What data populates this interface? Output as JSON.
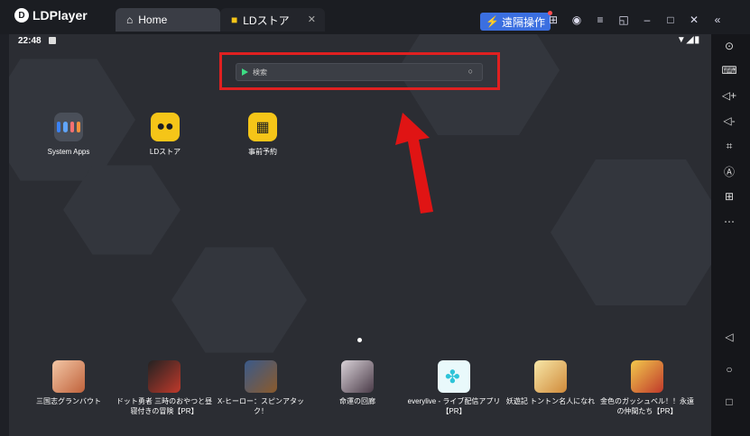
{
  "titlebar": {
    "logo_text": "LDPlayer",
    "tabs": [
      {
        "label": "Home",
        "icon": "home-icon"
      },
      {
        "label": "LDストア",
        "icon": "gamepad-icon"
      }
    ],
    "remote_button_label": "遠隔操作",
    "icons": [
      "gamepad-icon",
      "user-icon",
      "menu-icon",
      "window-icon",
      "minimize-icon",
      "maximize-icon",
      "close-icon"
    ],
    "collapse_icon": "collapse-icon"
  },
  "statusbar": {
    "time": "22:48"
  },
  "search": {
    "placeholder": "検索"
  },
  "home_apps": [
    {
      "label": "System Apps"
    },
    {
      "label": "LDストア"
    },
    {
      "label": "事前予約"
    }
  ],
  "dock_apps": [
    {
      "label": "三国志グランバウト"
    },
    {
      "label": "ドット勇者 三時のおやつと昼寝付きの冒険【PR】"
    },
    {
      "label": "X-ヒーロー：スピンアタック！"
    },
    {
      "label": "命運の回廊"
    },
    {
      "label": "everylive - ライブ配信アプリ【PR】"
    },
    {
      "label": "妖遊記 トントン名人になれ"
    },
    {
      "label": "金色のガッシュベル！！永遠の仲間たち【PR】"
    }
  ],
  "colors": {
    "accent": "#3b6fe0",
    "highlight": "#e02020",
    "ldstore_yellow": "#f5c518"
  }
}
